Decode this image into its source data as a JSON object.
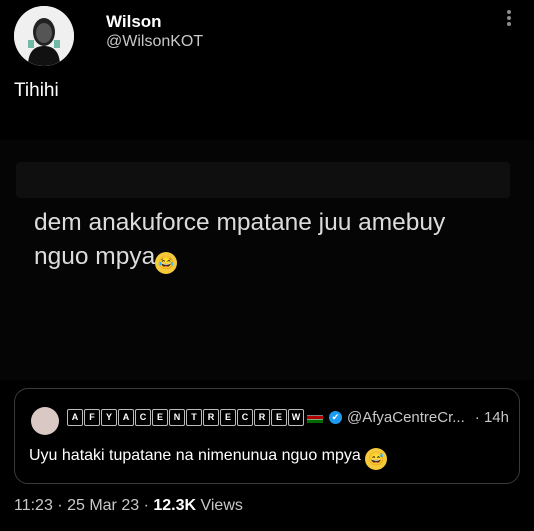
{
  "author": {
    "name": "Wilson",
    "handle": "@WilsonKOT"
  },
  "tweet": {
    "text": "Tihihi"
  },
  "media": {
    "line1": "dem anakuforce mpatane juu amebuy",
    "line2": "nguo mpya",
    "emoji": "😂"
  },
  "quote": {
    "letters": [
      "A",
      "F",
      "Y",
      "A",
      "C",
      "E",
      "N",
      "T",
      "R",
      "E",
      "C",
      "R",
      "E",
      "W"
    ],
    "verified_mark": "✔",
    "handle": "@AfyaCentreCr...",
    "time": "· 14h",
    "text": "Uyu hataki tupatane na nimenunua  nguo mpya",
    "emoji": "😅"
  },
  "meta": {
    "time": "11:23",
    "sep1": " · ",
    "date": "25 Mar 23",
    "sep2": " · ",
    "views_count": "12.3K",
    "views_label": " Views"
  },
  "icons": [
    "avatar",
    "more-options-icon",
    "verified-icon",
    "kenya-flag-icon"
  ]
}
